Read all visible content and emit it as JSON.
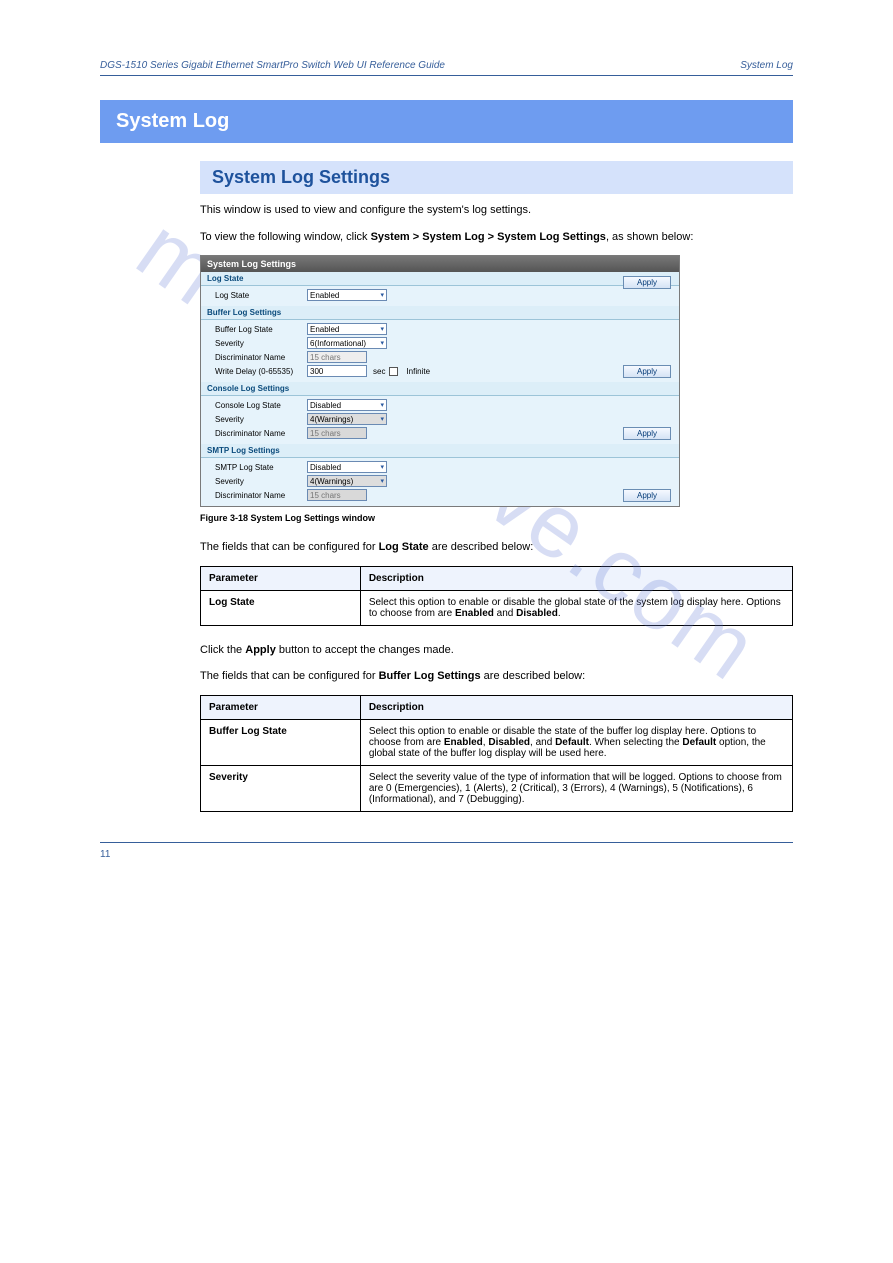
{
  "header": {
    "left": "DGS-1510 Series Gigabit Ethernet SmartPro Switch Web UI Reference Guide",
    "right": "System Log"
  },
  "watermark": "manualshive.com",
  "footer": "11",
  "chapter": "System Log",
  "section": {
    "title": "System Log Settings",
    "intro1": "This window is used to view and configure the system's log settings.",
    "intro2_a": "To view the following window, click ",
    "intro2_b": "System > System Log > System Log Settings",
    "intro2_c": ", as shown below:"
  },
  "figure_caption": "Figure 3-18 System Log Settings window",
  "log_state": {
    "label": "Log State",
    "lead": "The fields that can be configured for ",
    "lead_name": "Log State",
    "lead_after": " are described below:",
    "col1": "Parameter",
    "col2": "Description",
    "rows": [
      {
        "p": "Log State",
        "d_a": "Select this option to enable or disable the global state of the system log display here. Options to choose from are ",
        "d_enabled": "Enabled",
        "d_and": " and ",
        "d_disabled": "Disabled",
        "d_end": "."
      }
    ],
    "apply_note_a": "Click the ",
    "apply_note_b": "Apply",
    "apply_note_c": " button to accept the changes made."
  },
  "buffer_log": {
    "label": "Buffer Log Settings",
    "lead": "The fields that can be configured for ",
    "lead_name": "Buffer Log Settings",
    "lead_after": " are described below:",
    "col1": "Parameter",
    "col2": "Description",
    "rows": [
      {
        "p": "Buffer Log State",
        "d_a": "Select this option to enable or disable the state of the buffer log display here. Options to choose from are ",
        "d_b": "Enabled",
        "d_c": ", ",
        "d_d": "Disabled",
        "d_e": ", and ",
        "d_f": "Default",
        "d_g": ". When selecting the ",
        "d_h": "Default",
        "d_i": " option, the global state of the buffer log display will be used here."
      },
      {
        "p": "Severity",
        "d": "Select the severity value of the type of information that will be logged. Options to choose from are 0 (Emergencies), 1 (Alerts), 2 (Critical), 3 (Errors), 4 (Warnings), 5 (Notifications), 6 (Informational), and 7 (Debugging)."
      }
    ]
  },
  "ui": {
    "title": "System Log Settings",
    "apply": "Apply",
    "sections": {
      "log_state": {
        "head": "Log State",
        "rows": {
          "log_state": {
            "label": "Log State",
            "value": "Enabled"
          }
        }
      },
      "buffer": {
        "head": "Buffer Log Settings",
        "rows": {
          "state": {
            "label": "Buffer Log State",
            "value": "Enabled"
          },
          "severity": {
            "label": "Severity",
            "value": "6(Informational)"
          },
          "discr": {
            "label": "Discriminator Name",
            "placeholder": "15 chars"
          },
          "delay": {
            "label": "Write Delay (0-65535)",
            "value": "300",
            "unit": "sec",
            "cb_label": "Infinite"
          }
        }
      },
      "console": {
        "head": "Console Log Settings",
        "rows": {
          "state": {
            "label": "Console Log State",
            "value": "Disabled"
          },
          "severity": {
            "label": "Severity",
            "value": "4(Warnings)"
          },
          "discr": {
            "label": "Discriminator Name",
            "placeholder": "15 chars"
          }
        }
      },
      "smtp": {
        "head": "SMTP Log Settings",
        "rows": {
          "state": {
            "label": "SMTP Log State",
            "value": "Disabled"
          },
          "severity": {
            "label": "Severity",
            "value": "4(Warnings)"
          },
          "discr": {
            "label": "Discriminator Name",
            "placeholder": "15 chars"
          }
        }
      }
    }
  }
}
